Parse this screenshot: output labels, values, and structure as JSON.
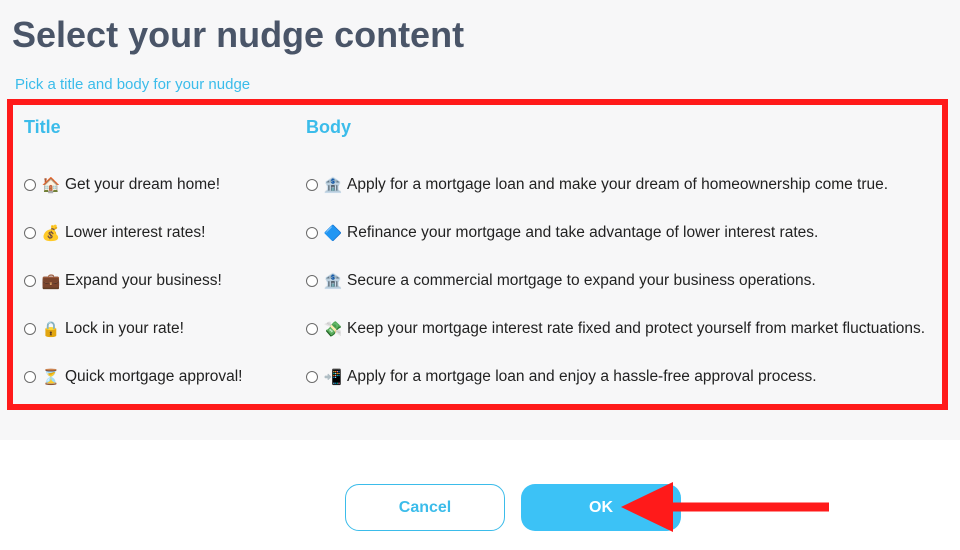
{
  "header": {
    "title": "Select your nudge content",
    "subtitle": "Pick a title and body for your nudge"
  },
  "columns": {
    "title_heading": "Title",
    "body_heading": "Body"
  },
  "titles": [
    {
      "icon": "house-icon",
      "glyph": "🏠",
      "label": "Get your dream home!"
    },
    {
      "icon": "money-bag-icon",
      "glyph": "💰",
      "label": "Lower interest rates!"
    },
    {
      "icon": "briefcase-icon",
      "glyph": "💼",
      "label": "Expand your business!"
    },
    {
      "icon": "lock-icon",
      "glyph": "🔒",
      "label": "Lock in your rate!"
    },
    {
      "icon": "hourglass-icon",
      "glyph": "⏳",
      "label": "Quick mortgage approval!"
    }
  ],
  "bodies": [
    {
      "icon": "bank-icon",
      "glyph": "🏦",
      "label": "Apply for a mortgage loan and make your dream of homeownership come true."
    },
    {
      "icon": "blue-diamond-icon",
      "glyph": "🔷",
      "label": "Refinance your mortgage and take advantage of lower interest rates."
    },
    {
      "icon": "bank-icon",
      "glyph": "🏦",
      "label": "Secure a commercial mortgage to expand your business operations."
    },
    {
      "icon": "money-wings-icon",
      "glyph": "💸",
      "label": "Keep your mortgage interest rate fixed and protect yourself from market fluctuations."
    },
    {
      "icon": "mobile-arrow-icon",
      "glyph": "📲",
      "label": "Apply for a mortgage loan and enjoy a hassle-free approval process."
    }
  ],
  "buttons": {
    "cancel_label": "Cancel",
    "ok_label": "OK"
  },
  "colors": {
    "accent": "#3bbcea",
    "highlight": "#ff1a1a",
    "title_text": "#4a5568"
  }
}
